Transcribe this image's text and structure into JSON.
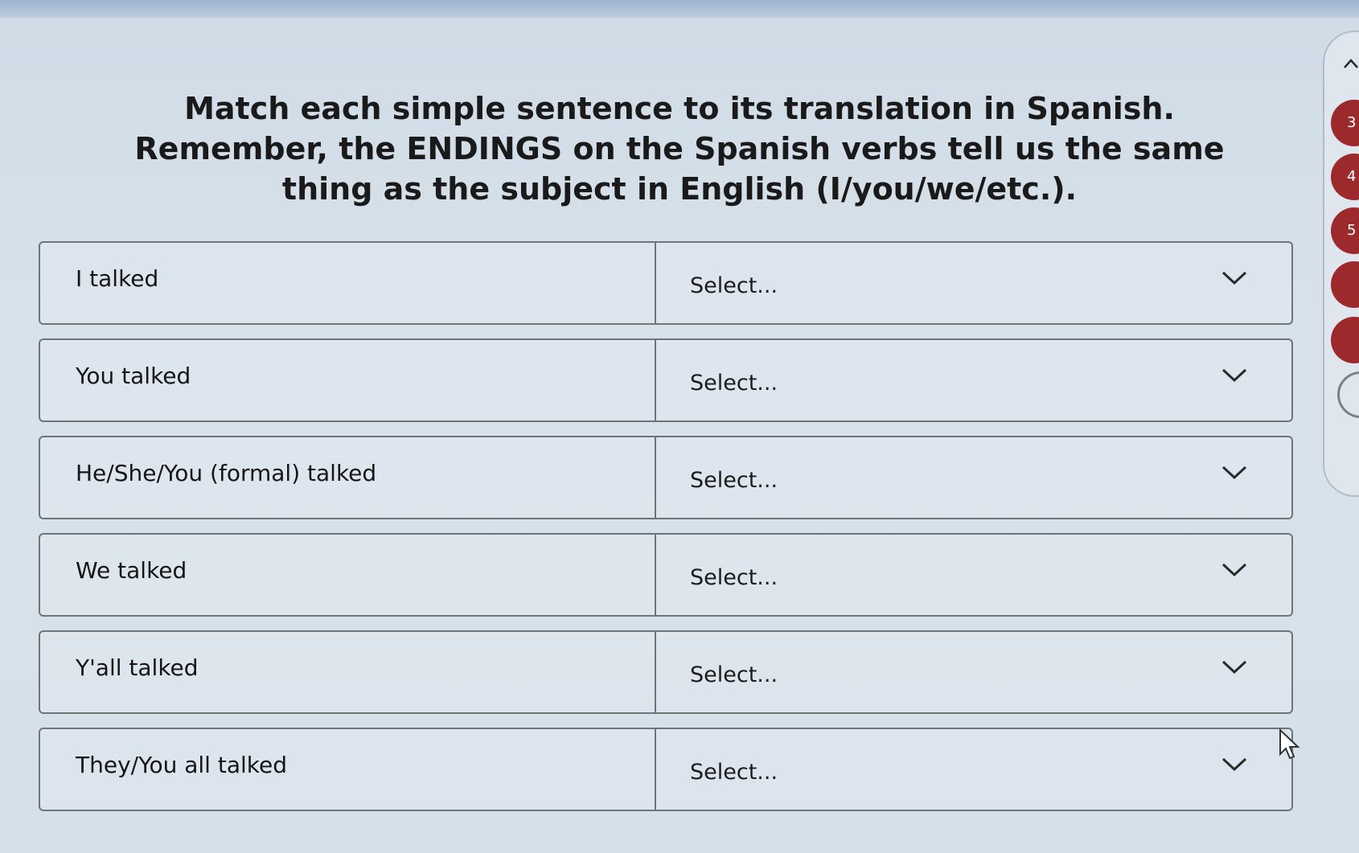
{
  "instructions": {
    "line1": "Match each simple sentence to its translation in Spanish.",
    "line2": "Remember, the ENDINGS on the Spanish verbs tell us the same",
    "line3": "thing as the subject in English (I/you/we/etc.)."
  },
  "rows": [
    {
      "prompt": "I talked",
      "select": "Select..."
    },
    {
      "prompt": "You talked",
      "select": "Select..."
    },
    {
      "prompt": "He/She/You (formal) talked",
      "select": "Select..."
    },
    {
      "prompt": "We talked",
      "select": "Select..."
    },
    {
      "prompt": "Y'all talked",
      "select": "Select..."
    },
    {
      "prompt": "They/You all talked",
      "select": "Select..."
    }
  ],
  "question_nav": {
    "visible_numbers": [
      "3",
      "4",
      "5",
      "",
      "",
      ""
    ],
    "badge_color": "#9c2a2d"
  },
  "icons": {
    "dropdown": "chevron-down-icon",
    "panel_collapse": "chevron-up-icon",
    "pointer": "mouse-cursor-icon"
  }
}
